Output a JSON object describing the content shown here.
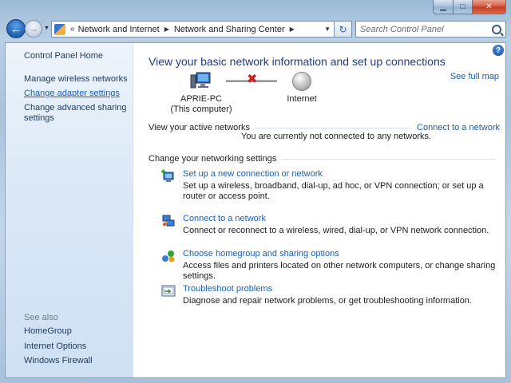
{
  "window": {
    "minimize_glyph": "▁",
    "maximize_glyph": "□",
    "close_glyph": "✕"
  },
  "navigation": {
    "back_glyph": "←",
    "forward_glyph": "→",
    "recent_dropdown_glyph": "▼",
    "refresh_glyph": "↻"
  },
  "address_bar": {
    "breadcrumbs": [
      "Network and Internet",
      "Network and Sharing Center"
    ],
    "separator": "▶",
    "overflow": "«",
    "dropdown_glyph": "▼"
  },
  "search": {
    "placeholder": "Search Control Panel"
  },
  "sidebar": {
    "home": "Control Panel Home",
    "items": [
      "Manage wireless networks",
      "Change adapter settings",
      "Change advanced sharing settings"
    ],
    "see_also_heading": "See also",
    "see_also": [
      "HomeGroup",
      "Internet Options",
      "Windows Firewall"
    ]
  },
  "main": {
    "help_glyph": "?",
    "title": "View your basic network information and set up connections",
    "see_full_map": "See full map",
    "network_map": {
      "computer_name": "APRIE-PC",
      "computer_sub": "(This computer)",
      "internet_label": "Internet",
      "status_mark": "✖"
    },
    "active_networks": {
      "heading": "View your active networks",
      "link": "Connect to a network",
      "status": "You are currently not connected to any networks."
    },
    "settings_heading": "Change your networking settings",
    "tasks": [
      {
        "link": "Set up a new connection or network",
        "desc": "Set up a wireless, broadband, dial-up, ad hoc, or VPN connection; or set up a router or access point."
      },
      {
        "link": "Connect to a network",
        "desc": "Connect or reconnect to a wireless, wired, dial-up, or VPN network connection."
      },
      {
        "link": "Choose homegroup and sharing options",
        "desc": "Access files and printers located on other network computers, or change sharing settings."
      },
      {
        "link": "Troubleshoot problems",
        "desc": "Diagnose and repair network problems, or get troubleshooting information."
      }
    ]
  }
}
